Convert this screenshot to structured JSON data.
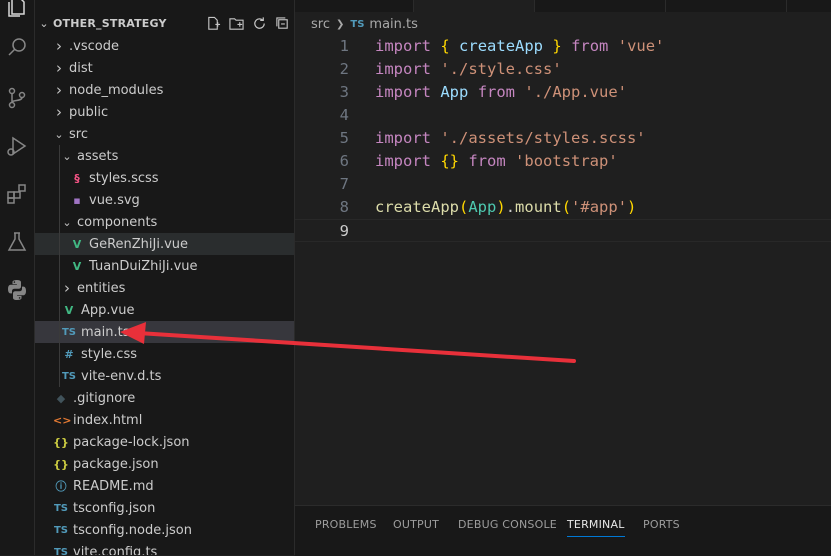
{
  "explorer": {
    "title": "OTHER_STRATEGY",
    "items": [
      {
        "label": ".vscode",
        "kind": "folder",
        "open": false,
        "depth": 0
      },
      {
        "label": "dist",
        "kind": "folder",
        "open": false,
        "depth": 0
      },
      {
        "label": "node_modules",
        "kind": "folder",
        "open": false,
        "depth": 0
      },
      {
        "label": "public",
        "kind": "folder",
        "open": false,
        "depth": 0
      },
      {
        "label": "src",
        "kind": "folder",
        "open": true,
        "depth": 0
      },
      {
        "label": "assets",
        "kind": "folder",
        "open": true,
        "depth": 1
      },
      {
        "label": "styles.scss",
        "kind": "scss",
        "depth": 2
      },
      {
        "label": "vue.svg",
        "kind": "svg",
        "depth": 2
      },
      {
        "label": "components",
        "kind": "folder",
        "open": true,
        "depth": 1
      },
      {
        "label": "GeRenZhiJi.vue",
        "kind": "vue",
        "depth": 2
      },
      {
        "label": "TuanDuiZhiJi.vue",
        "kind": "vue",
        "depth": 2
      },
      {
        "label": "entities",
        "kind": "folder",
        "open": false,
        "depth": 1
      },
      {
        "label": "App.vue",
        "kind": "vue",
        "depth": 1
      },
      {
        "label": "main.ts",
        "kind": "ts",
        "depth": 1
      },
      {
        "label": "style.css",
        "kind": "css",
        "depth": 1
      },
      {
        "label": "vite-env.d.ts",
        "kind": "ts",
        "depth": 1
      },
      {
        "label": ".gitignore",
        "kind": "git",
        "depth": 0
      },
      {
        "label": "index.html",
        "kind": "html",
        "depth": 0
      },
      {
        "label": "package-lock.json",
        "kind": "json",
        "depth": 0
      },
      {
        "label": "package.json",
        "kind": "json",
        "depth": 0
      },
      {
        "label": "README.md",
        "kind": "info",
        "depth": 0
      },
      {
        "label": "tsconfig.json",
        "kind": "ts",
        "depth": 0
      },
      {
        "label": "tsconfig.node.json",
        "kind": "ts",
        "depth": 0
      },
      {
        "label": "vite.config.ts",
        "kind": "ts",
        "depth": 0
      }
    ]
  },
  "file_icons": {
    "ts": "TS",
    "vue": "V",
    "scss": "§",
    "css": "#",
    "json": "{}",
    "html": "<>",
    "info": "ⓘ",
    "git": "◆",
    "svg": "▪"
  },
  "breadcrumb": {
    "folder": "src",
    "file_icon": "TS",
    "file": "main.ts"
  },
  "code_lines": [
    {
      "n": "1",
      "tokens": [
        [
          "kw",
          "import"
        ],
        [
          "pun",
          " "
        ],
        [
          "br1",
          "{"
        ],
        [
          "pun",
          " "
        ],
        [
          "var",
          "createApp"
        ],
        [
          "pun",
          " "
        ],
        [
          "br1",
          "}"
        ],
        [
          "pun",
          " "
        ],
        [
          "kw",
          "from"
        ],
        [
          "pun",
          " "
        ],
        [
          "str",
          "'vue'"
        ]
      ]
    },
    {
      "n": "2",
      "tokens": [
        [
          "kw",
          "import"
        ],
        [
          "pun",
          " "
        ],
        [
          "str",
          "'./style.css'"
        ]
      ]
    },
    {
      "n": "3",
      "tokens": [
        [
          "kw",
          "import"
        ],
        [
          "pun",
          " "
        ],
        [
          "var",
          "App"
        ],
        [
          "pun",
          " "
        ],
        [
          "kw",
          "from"
        ],
        [
          "pun",
          " "
        ],
        [
          "str",
          "'./App.vue'"
        ]
      ]
    },
    {
      "n": "4",
      "tokens": []
    },
    {
      "n": "5",
      "tokens": [
        [
          "kw",
          "import"
        ],
        [
          "pun",
          " "
        ],
        [
          "str",
          "'./assets/styles.scss'"
        ]
      ]
    },
    {
      "n": "6",
      "tokens": [
        [
          "kw",
          "import"
        ],
        [
          "pun",
          " "
        ],
        [
          "br1",
          "{}"
        ],
        [
          "pun",
          " "
        ],
        [
          "kw",
          "from"
        ],
        [
          "pun",
          " "
        ],
        [
          "str",
          "'bootstrap'"
        ]
      ]
    },
    {
      "n": "7",
      "tokens": []
    },
    {
      "n": "8",
      "tokens": [
        [
          "fn",
          "createApp"
        ],
        [
          "br1",
          "("
        ],
        [
          "cls",
          "App"
        ],
        [
          "br1",
          ")"
        ],
        [
          "pun",
          "."
        ],
        [
          "fn",
          "mount"
        ],
        [
          "br1",
          "("
        ],
        [
          "str",
          "'#app'"
        ],
        [
          "br1",
          ")"
        ]
      ]
    },
    {
      "n": "9",
      "tokens": []
    }
  ],
  "panel": {
    "tabs": [
      "PROBLEMS",
      "OUTPUT",
      "DEBUG CONSOLE",
      "TERMINAL",
      "PORTS"
    ],
    "active": "TERMINAL"
  },
  "colors": {
    "arrow": "#e8303a",
    "accent": "#0078d4"
  }
}
